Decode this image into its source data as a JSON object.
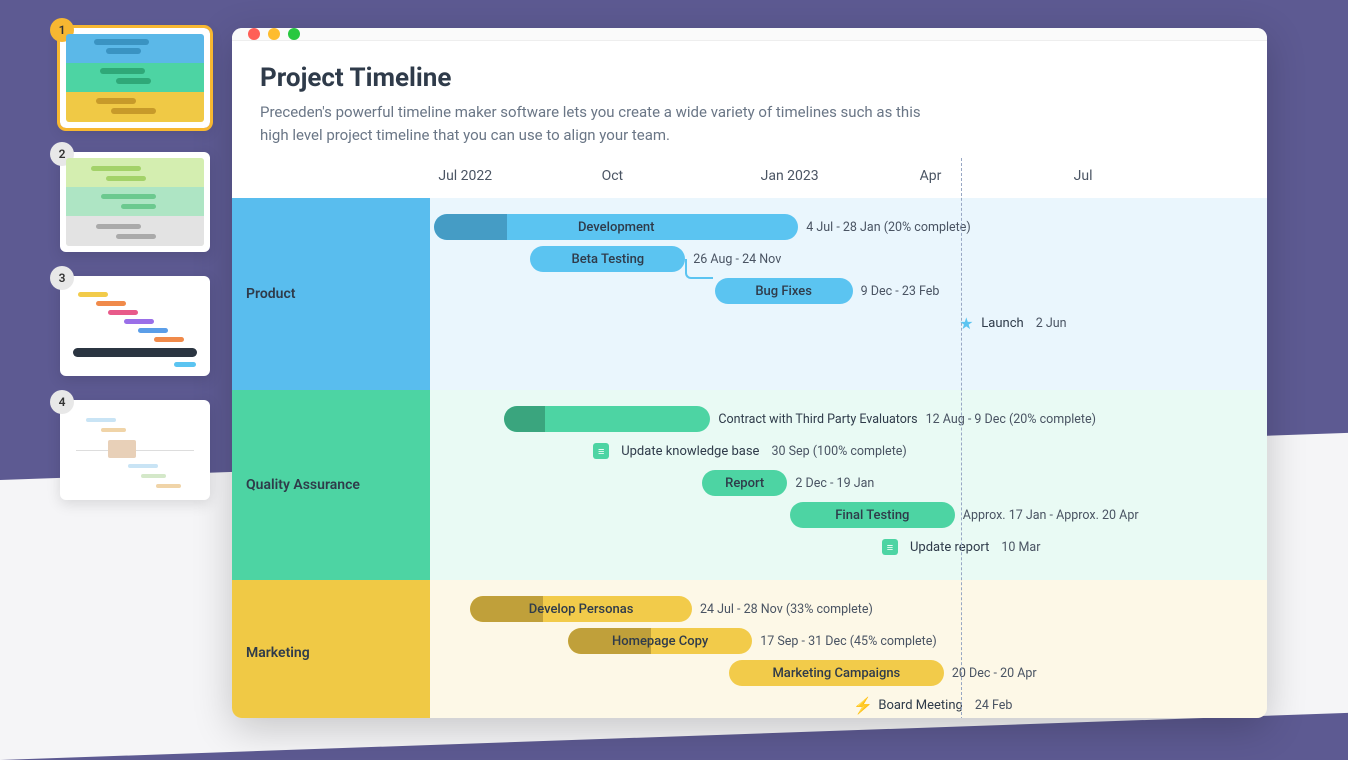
{
  "thumbnails": [
    {
      "num": "1",
      "active": true
    },
    {
      "num": "2",
      "active": false
    },
    {
      "num": "3",
      "active": false
    },
    {
      "num": "4",
      "active": false
    }
  ],
  "header": {
    "title": "Project Timeline",
    "subtitle": "Preceden's powerful timeline maker software lets you create a wide variety of timelines such as this high level project timeline that you can use to align your team."
  },
  "axis": {
    "ticks": [
      {
        "label": "Jul 2022",
        "pct": 1
      },
      {
        "label": "Oct",
        "pct": 20.5
      },
      {
        "label": "Jan 2023",
        "pct": 39.5
      },
      {
        "label": "Apr",
        "pct": 58.5
      },
      {
        "label": "Jul",
        "pct": 76.9
      }
    ],
    "today_pct": 63.5
  },
  "lanes": {
    "product": {
      "label": "Product"
    },
    "qa": {
      "label": "Quality Assurance"
    },
    "mktg": {
      "label": "Marketing"
    }
  },
  "chart_data": {
    "type": "gantt",
    "date_range_start": "2022-07-01",
    "lanes": [
      {
        "name": "Product",
        "color": "#5bc4f1",
        "items": [
          {
            "kind": "bar",
            "label": "Development",
            "row": 0,
            "start_pct": 0.5,
            "width_pct": 43.5,
            "progress_pct": 20,
            "meta": "4 Jul - 28 Jan (20% complete)"
          },
          {
            "kind": "bar",
            "label": "Beta Testing",
            "row": 1,
            "start_pct": 12.0,
            "width_pct": 18.5,
            "meta": "26 Aug - 24 Nov"
          },
          {
            "kind": "bar",
            "label": "Bug Fixes",
            "row": 2,
            "start_pct": 34.0,
            "width_pct": 16.5,
            "meta": "9 Dec - 23 Feb"
          },
          {
            "kind": "milestone",
            "icon": "star",
            "label": "Launch",
            "row": 3,
            "at_pct": 63.0,
            "meta": "2 Jun"
          }
        ]
      },
      {
        "name": "Quality Assurance",
        "color": "#4dd4a3",
        "items": [
          {
            "kind": "bar",
            "label": "Contract with Third Party Evaluators",
            "row": 0,
            "start_pct": 8.8,
            "width_pct": 24.7,
            "progress_pct": 20,
            "label_outside": true,
            "meta": "12 Aug - 9 Dec (20% complete)"
          },
          {
            "kind": "milestone",
            "icon": "note",
            "label": "Update knowledge base",
            "row": 1,
            "at_pct": 19.5,
            "meta": "30 Sep (100% complete)"
          },
          {
            "kind": "bar",
            "label": "Report",
            "row": 2,
            "start_pct": 32.5,
            "width_pct": 10.2,
            "meta": "2 Dec - 19 Jan"
          },
          {
            "kind": "bar",
            "label": "Final Testing",
            "row": 3,
            "start_pct": 43.0,
            "width_pct": 19.7,
            "meta": "Approx. 17 Jan - Approx. 20 Apr"
          },
          {
            "kind": "milestone",
            "icon": "note",
            "label": "Update report",
            "row": 4,
            "at_pct": 54.0,
            "meta": "10 Mar"
          }
        ]
      },
      {
        "name": "Marketing",
        "color": "#f2cb4a",
        "items": [
          {
            "kind": "bar",
            "label": "Develop Personas",
            "row": 0,
            "start_pct": 4.8,
            "width_pct": 26.5,
            "progress_pct": 33,
            "meta": "24 Jul - 28 Nov (33% complete)"
          },
          {
            "kind": "bar",
            "label": "Homepage Copy",
            "row": 1,
            "start_pct": 16.5,
            "width_pct": 22.0,
            "progress_pct": 45,
            "meta": "17 Sep - 31 Dec (45% complete)"
          },
          {
            "kind": "bar",
            "label": "Marketing Campaigns",
            "row": 2,
            "start_pct": 35.7,
            "width_pct": 25.7,
            "meta": "20 Dec - 20 Apr"
          },
          {
            "kind": "milestone",
            "icon": "bolt",
            "label": "Board Meeting",
            "row": 3,
            "at_pct": 50.7,
            "meta": "24 Feb"
          }
        ]
      }
    ]
  }
}
